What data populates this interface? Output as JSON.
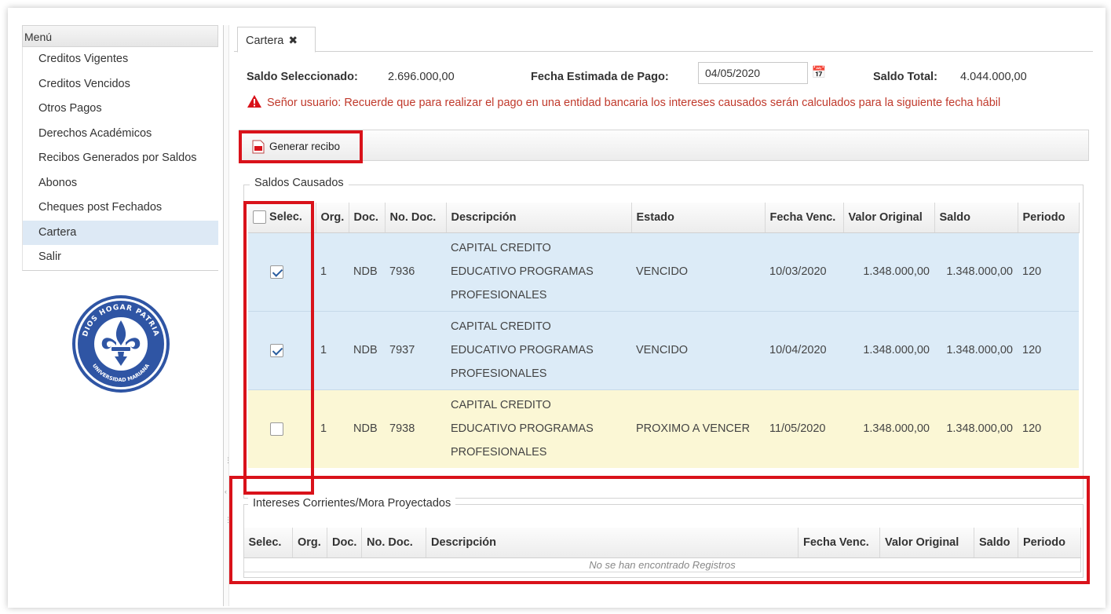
{
  "menu": {
    "header": "Menú",
    "items": [
      {
        "label": "Creditos Vigentes"
      },
      {
        "label": "Creditos Vencidos"
      },
      {
        "label": "Otros Pagos"
      },
      {
        "label": "Derechos Académicos"
      },
      {
        "label": "Recibos Generados por Saldos"
      },
      {
        "label": "Abonos"
      },
      {
        "label": "Cheques post Fechados"
      },
      {
        "label": "Cartera",
        "active": true
      },
      {
        "label": "Salir"
      }
    ]
  },
  "logo": {
    "top_text": "DIOS HOGAR PATRIA",
    "bottom_text": "UNIVERSIDAD MARIANA",
    "color": "#2f55a4"
  },
  "tab": {
    "label": "Cartera",
    "close": "✖"
  },
  "summary": {
    "saldo_seleccionado_label": "Saldo Seleccionado:",
    "saldo_seleccionado_value": "2.696.000,00",
    "fecha_label": "Fecha Estimada de Pago:",
    "fecha_value": "04/05/2020",
    "saldo_total_label": "Saldo Total:",
    "saldo_total_value": "4.044.000,00"
  },
  "warning": "Señor usuario: Recuerde que para realizar el pago en una entidad bancaria los intereses causados serán calculados para la siguiente fecha hábil",
  "toolbar": {
    "generate_label": "Generar recibo"
  },
  "saldos": {
    "legend": "Saldos Causados",
    "columns": [
      "Selec.",
      "Org.",
      "Doc.",
      "No. Doc.",
      "Descripción",
      "Estado",
      "Fecha Venc.",
      "Valor Original",
      "Saldo",
      "Periodo"
    ],
    "rows": [
      {
        "checked": true,
        "org": "1",
        "doc": "NDB",
        "no_doc": "7936",
        "desc1": "CAPITAL CREDITO",
        "desc2": "EDUCATIVO PROGRAMAS",
        "desc3": "PROFESIONALES",
        "estado": "VENCIDO",
        "fecha": "10/03/2020",
        "valor": "1.348.000,00",
        "saldo": "1.348.000,00",
        "periodo": "120"
      },
      {
        "checked": true,
        "org": "1",
        "doc": "NDB",
        "no_doc": "7937",
        "desc1": "CAPITAL CREDITO",
        "desc2": "EDUCATIVO PROGRAMAS",
        "desc3": "PROFESIONALES",
        "estado": "VENCIDO",
        "fecha": "10/04/2020",
        "valor": "1.348.000,00",
        "saldo": "1.348.000,00",
        "periodo": "120"
      },
      {
        "checked": false,
        "org": "1",
        "doc": "NDB",
        "no_doc": "7938",
        "desc1": "CAPITAL CREDITO",
        "desc2": "EDUCATIVO PROGRAMAS",
        "desc3": "PROFESIONALES",
        "estado": "PROXIMO A VENCER",
        "fecha": "11/05/2020",
        "valor": "1.348.000,00",
        "saldo": "1.348.000,00",
        "periodo": "120"
      }
    ]
  },
  "intereses": {
    "legend": "Intereses Corrientes/Mora Proyectados",
    "columns": [
      "Selec.",
      "Org.",
      "Doc.",
      "No. Doc.",
      "Descripción",
      "Fecha Venc.",
      "Valor Original",
      "Saldo",
      "Periodo"
    ],
    "empty": "No se han encontrado Registros"
  },
  "colors": {
    "highlight_red": "#d9121a",
    "warning_red": "#c0392b",
    "row_vencido": "#dcebf7",
    "row_proximo": "#fbf7d5"
  }
}
